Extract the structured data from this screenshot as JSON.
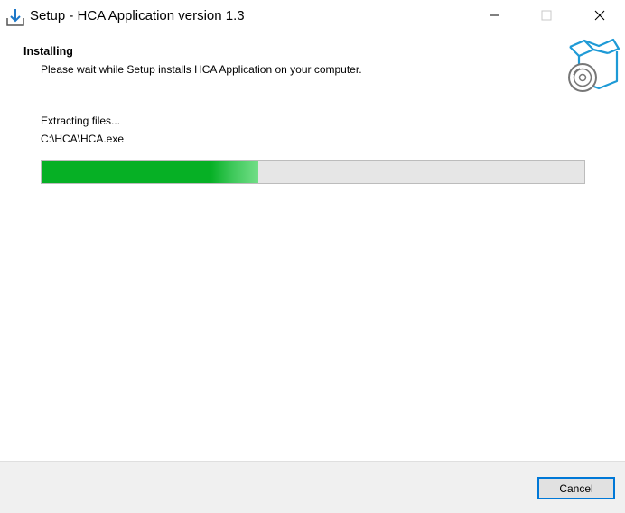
{
  "window": {
    "title": "Setup - HCA Application version 1.3",
    "controls": {
      "minimize": "minimize-icon",
      "maximize": "maximize-icon",
      "close": "close-icon"
    }
  },
  "header": {
    "title": "Installing",
    "subtitle": "Please wait while Setup installs HCA Application on your computer.",
    "graphic": "box-with-disc-icon"
  },
  "progress": {
    "status": "Extracting files...",
    "current_file": "C:\\HCA\\HCA.exe",
    "fraction": 0.4,
    "color": "#06b025"
  },
  "footer": {
    "cancel_label": "Cancel"
  },
  "colors": {
    "accent": "#0078d7",
    "footer_bg": "#f0f0f0",
    "progress_fill": "#06b025",
    "progress_track": "#e6e6e6",
    "graphic_blue": "#1e9ad6"
  }
}
